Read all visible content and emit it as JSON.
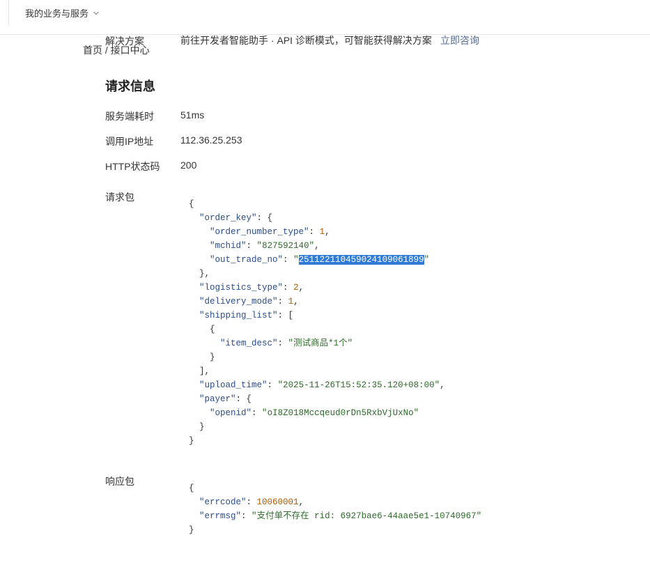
{
  "topbar": {
    "menu_label": "我的业务与服务"
  },
  "breadcrumb": "首页 / 接口中心",
  "solution": {
    "label": "解决方案",
    "text": "前往开发者智能助手 · API 诊断模式，可智能获得解决方案",
    "link": "立即咨询"
  },
  "request_info": {
    "title": "请求信息",
    "rows": [
      {
        "label": "服务端耗时",
        "value": "51ms"
      },
      {
        "label": "调用IP地址",
        "value": "112.36.25.253"
      },
      {
        "label": "HTTP状态码",
        "value": "200"
      }
    ],
    "request_label": "请求包",
    "request": {
      "order_key": {
        "order_number_type": "1",
        "mchid": "827592140",
        "out_trade_no": "251122110459024109061899"
      },
      "logistics_type": "2",
      "delivery_mode": "1",
      "shipping_list_item_desc": "测试商品*1个",
      "upload_time": "2025-11-26T15:52:35.120+08:00",
      "payer_openid": "oI8Z018Mccqeud0rDn5RxbVjUxNo"
    },
    "response_label": "响应包",
    "response": {
      "errcode": "10060001",
      "errmsg": "支付单不存在 rid: 6927bae6-44aae5e1-10740967"
    }
  }
}
